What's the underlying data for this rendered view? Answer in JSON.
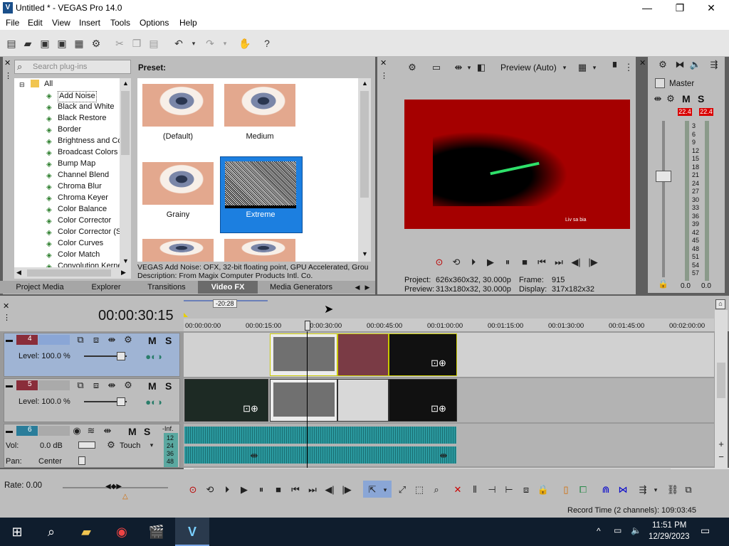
{
  "window": {
    "title": "Untitled * - VEGAS Pro 14.0",
    "minimize": "—",
    "maximize": "❐",
    "close": "✕"
  },
  "menu": [
    "File",
    "Edit",
    "View",
    "Insert",
    "Tools",
    "Options",
    "Help"
  ],
  "plugins": {
    "search_placeholder": "Search plug-ins",
    "root": "All",
    "items": [
      "Add Noise",
      "Black and White",
      "Black Restore",
      "Border",
      "Brightness and Co",
      "Broadcast Colors",
      "Bump Map",
      "Channel Blend",
      "Chroma Blur",
      "Chroma Keyer",
      "Color Balance",
      "Color Corrector",
      "Color Corrector (S",
      "Color Curves",
      "Color Match",
      "Convolution Kerne"
    ]
  },
  "presets": {
    "label": "Preset:",
    "items": [
      "(Default)",
      "Medium",
      "Grainy",
      "Extreme"
    ]
  },
  "description": {
    "line1": "VEGAS Add Noise: OFX, 32-bit floating point, GPU Accelerated, Grou",
    "line2": "Description: From Magix Computer Products Intl. Co."
  },
  "tabs": [
    "Project Media",
    "Explorer",
    "Transitions",
    "Video FX",
    "Media Generators"
  ],
  "preview": {
    "mode": "Preview (Auto)",
    "project_label": "Project:",
    "project_value": "626x360x32, 30.000p",
    "preview_label": "Preview:",
    "preview_value": "313x180x32, 30.000p",
    "frame_label": "Frame:",
    "frame_value": "915",
    "display_label": "Display:",
    "display_value": "317x182x32",
    "overlay_text": "Liv sa bia"
  },
  "mixer": {
    "title": "Master",
    "m": "M",
    "s": "S",
    "peak_left": "22.4",
    "peak_right": "22.4",
    "scale": [
      "3",
      "6",
      "9",
      "12",
      "15",
      "18",
      "21",
      "24",
      "27",
      "30",
      "33",
      "36",
      "39",
      "42",
      "45",
      "48",
      "51",
      "54",
      "57"
    ],
    "level_left": "0.0",
    "level_right": "0.0"
  },
  "timeline": {
    "timecode": "00:00:30:15",
    "marker": "-20:28",
    "ruler": [
      "00:00:00:00",
      "00:00:15:00",
      "00:00:30:00",
      "00:00:45:00",
      "00:01:00:00",
      "00:01:15:00",
      "00:01:30:00",
      "00:01:45:00",
      "00:02:00:00"
    ],
    "tracks": [
      {
        "num": "4",
        "level": "Level: 100.0 %"
      },
      {
        "num": "5",
        "level": "Level: 100.0 %"
      },
      {
        "num": "6",
        "vol_label": "Vol:",
        "vol_value": "0.0 dB",
        "pan_label": "Pan:",
        "pan_value": "Center",
        "touch": "Touch",
        "inf": "-Inf.",
        "db_scale": [
          "12",
          "24",
          "36",
          "48"
        ]
      }
    ],
    "m": "M",
    "s": "S"
  },
  "transport": {
    "rate": "Rate: 0.00"
  },
  "status": {
    "record_time": "Record Time (2 channels): 109:03:45"
  },
  "taskbar": {
    "time": "11:51 PM",
    "date": "12/29/2023"
  },
  "colors": {
    "accent_selected": "#1c7fe0",
    "preview_red": "#a50000",
    "audio_wave": "#2b9aa0",
    "peak_red": "#d90000"
  }
}
